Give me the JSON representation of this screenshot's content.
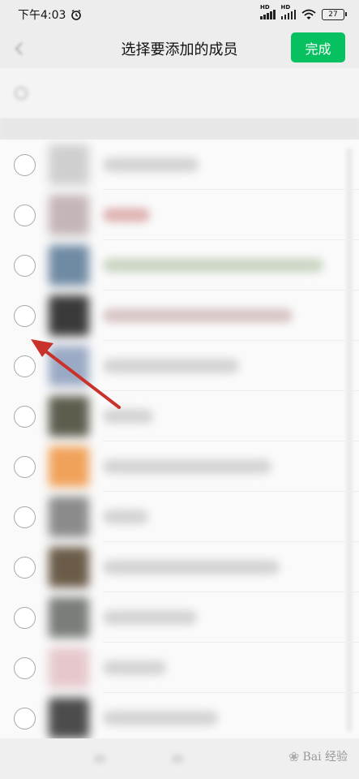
{
  "status_bar": {
    "time": "下午4:03",
    "signal1_label": "HD",
    "signal2_label": "HD",
    "battery_level": "27",
    "icons": [
      "alarm-icon",
      "signal-icon",
      "signal-icon",
      "wifi-icon",
      "battery-icon"
    ]
  },
  "nav": {
    "title": "选择要添加的成员",
    "done_label": "完成",
    "back_icon": "chevron-left-icon"
  },
  "colors": {
    "accent": "#07c160",
    "annotation_arrow": "#c8322a"
  },
  "contacts": [
    {
      "avatar_color": "#c9c9c9"
    },
    {
      "avatar_color": "#c4b5b8"
    },
    {
      "avatar_color": "#6f8aa3"
    },
    {
      "avatar_color": "#3a3a3a"
    },
    {
      "avatar_color": "#9aa9c4"
    },
    {
      "avatar_color": "#5d5d4e"
    },
    {
      "avatar_color": "#f0a25a"
    },
    {
      "avatar_color": "#8b8b8b"
    },
    {
      "avatar_color": "#6b5b48"
    },
    {
      "avatar_color": "#7a7e7a"
    },
    {
      "avatar_color": "#e6c8cc"
    },
    {
      "avatar_color": "#4c4c4c"
    }
  ],
  "watermark": {
    "text": "Bai 经验",
    "icon": "baidu-paw-icon"
  }
}
